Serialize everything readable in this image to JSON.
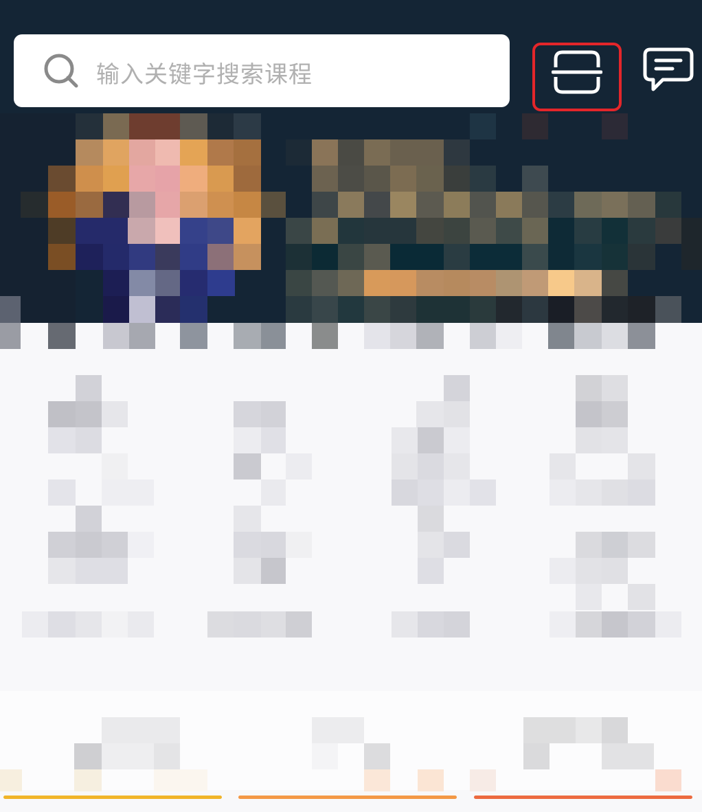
{
  "search": {
    "placeholder": "输入关键字搜索课程",
    "icon": "search-icon"
  },
  "toolbar": {
    "scan_icon": "scan-icon",
    "message_icon": "message-icon",
    "highlight_color": "#e4262a"
  },
  "colors": {
    "header_bg": "#142535",
    "page_bg": "#f8f8fa",
    "tab_indicator_1": "#f0b429",
    "tab_indicator_2": "#f39845",
    "tab_indicator_3": "#ec6a3f"
  },
  "banner": {
    "state": "pixelated"
  },
  "quick_nav": {
    "state": "pixelated"
  },
  "tabs": {
    "state": "pixelated"
  }
}
